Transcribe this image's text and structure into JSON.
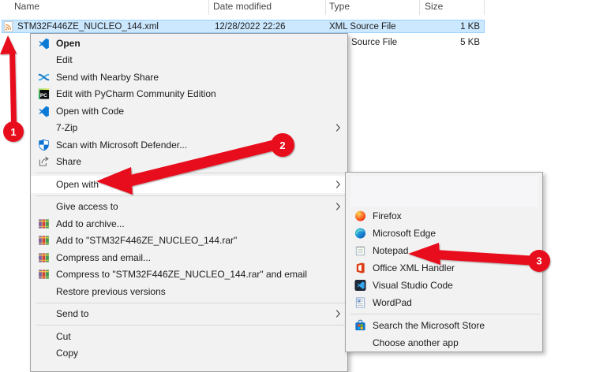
{
  "explorer": {
    "columns": [
      "Name",
      "Date modified",
      "Type",
      "Size"
    ],
    "selected_file": {
      "name": "STM32F446ZE_NUCLEO_144.xml",
      "date_modified": "12/28/2022 22:26",
      "type": "XML Source File",
      "size": "1 KB",
      "icon": "xml-file-icon"
    },
    "partial_row": {
      "type": "Source File",
      "size": "5 KB"
    }
  },
  "context_menu": {
    "items": [
      {
        "label": "Open",
        "icon": "vscode-icon",
        "bold": true
      },
      {
        "label": "Edit"
      },
      {
        "label": "Send with Nearby Share",
        "icon": "nearby-share-icon"
      },
      {
        "label": "Edit with PyCharm Community Edition",
        "icon": "pycharm-icon"
      },
      {
        "label": "Open with Code",
        "icon": "vscode-icon"
      },
      {
        "label": "7-Zip",
        "submenu": true
      },
      {
        "label": "Scan with Microsoft Defender...",
        "icon": "defender-icon"
      },
      {
        "label": "Share",
        "icon": "share-icon"
      },
      {
        "type": "separator"
      },
      {
        "label": "Open with",
        "submenu": true,
        "highlighted": true
      },
      {
        "type": "separator"
      },
      {
        "label": "Give access to",
        "submenu": true
      },
      {
        "label": "Add to archive...",
        "icon": "winrar-icon"
      },
      {
        "label": "Add to \"STM32F446ZE_NUCLEO_144.rar\"",
        "icon": "winrar-icon"
      },
      {
        "label": "Compress and email...",
        "icon": "winrar-icon"
      },
      {
        "label": "Compress to \"STM32F446ZE_NUCLEO_144.rar\" and email",
        "icon": "winrar-icon"
      },
      {
        "label": "Restore previous versions"
      },
      {
        "type": "separator"
      },
      {
        "label": "Send to",
        "submenu": true
      },
      {
        "type": "separator"
      },
      {
        "label": "Cut"
      },
      {
        "label": "Copy"
      }
    ]
  },
  "open_with_submenu": {
    "items": [
      {
        "type": "blank"
      },
      {
        "label": "Firefox",
        "icon": "firefox-icon"
      },
      {
        "label": "Microsoft Edge",
        "icon": "edge-icon"
      },
      {
        "label": "Notepad",
        "icon": "notepad-icon"
      },
      {
        "label": "Office XML Handler",
        "icon": "office-icon"
      },
      {
        "label": "Visual Studio Code",
        "icon": "vscode-dark-icon"
      },
      {
        "label": "WordPad",
        "icon": "wordpad-icon"
      },
      {
        "type": "separator"
      },
      {
        "label": "Search the Microsoft Store",
        "icon": "store-icon"
      },
      {
        "label": "Choose another app"
      }
    ]
  },
  "annotations": {
    "accent_color": "#e8101e",
    "steps": [
      {
        "label": "1"
      },
      {
        "label": "2"
      },
      {
        "label": "3"
      }
    ]
  }
}
